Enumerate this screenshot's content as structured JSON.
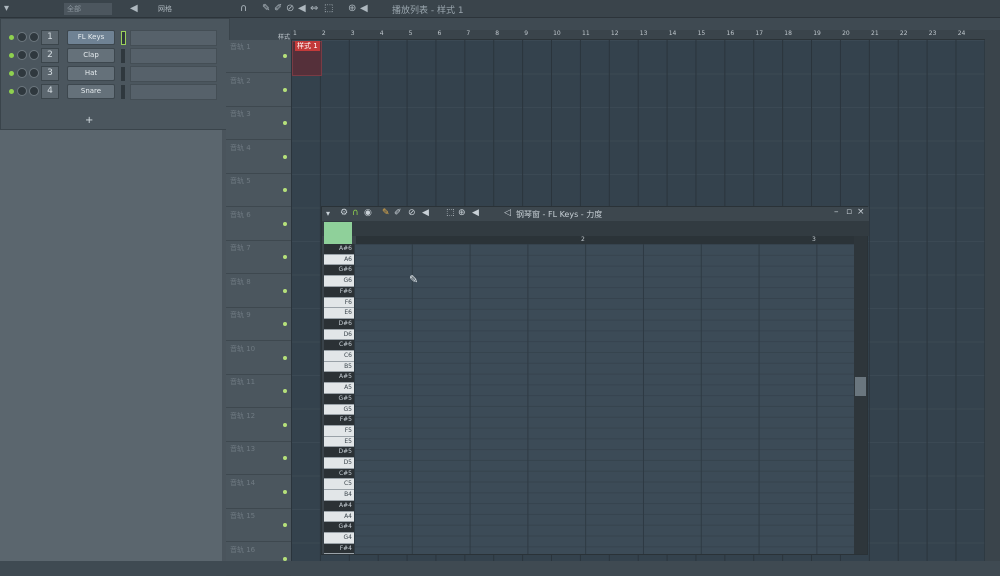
{
  "topbar": {
    "group_select": "全部",
    "snap_label": "网格",
    "playlist_title": "播放列表 - 样式 1",
    "icons": [
      "arrow-down-icon",
      "speaker-icon",
      "magnet-icon",
      "pencil-icon",
      "brush-icon",
      "delete-icon",
      "mute-icon",
      "slip-icon",
      "select-icon",
      "zoom-icon",
      "playback-icon"
    ]
  },
  "channel_rack": {
    "channels": [
      {
        "num": "1",
        "name": "FL Keys"
      },
      {
        "num": "2",
        "name": "Clap"
      },
      {
        "num": "3",
        "name": "Hat"
      },
      {
        "num": "4",
        "name": "Snare"
      }
    ],
    "add_label": "+"
  },
  "playlist": {
    "header_label": "样式",
    "clip_name": "样式 1",
    "tracks": [
      "音轨 1",
      "音轨 2",
      "音轨 3",
      "音轨 4",
      "音轨 5",
      "音轨 6",
      "音轨 7",
      "音轨 8",
      "音轨 9",
      "音轨 10",
      "音轨 11",
      "音轨 12",
      "音轨 13",
      "音轨 14",
      "音轨 15",
      "音轨 16"
    ],
    "ruler": [
      "1",
      "2",
      "3",
      "4",
      "5",
      "6",
      "7",
      "8",
      "9",
      "10",
      "11",
      "12",
      "13",
      "14",
      "15",
      "16",
      "17",
      "18",
      "19",
      "20",
      "21",
      "22",
      "23",
      "24"
    ]
  },
  "piano_roll": {
    "title": "钢琴窗 - FL Keys - 力度",
    "ruler": [
      "2",
      "3"
    ],
    "keys": [
      "A#6",
      "A6",
      "G#6",
      "G6",
      "F#6",
      "F6",
      "E6",
      "D#6",
      "D6",
      "C#6",
      "C6",
      "B5",
      "A#5",
      "A5",
      "G#5",
      "G5",
      "F#5",
      "F5",
      "E5",
      "D#5",
      "D5",
      "C#5",
      "C5",
      "B4",
      "A#4",
      "A4",
      "G#4",
      "G4",
      "F#4"
    ]
  }
}
